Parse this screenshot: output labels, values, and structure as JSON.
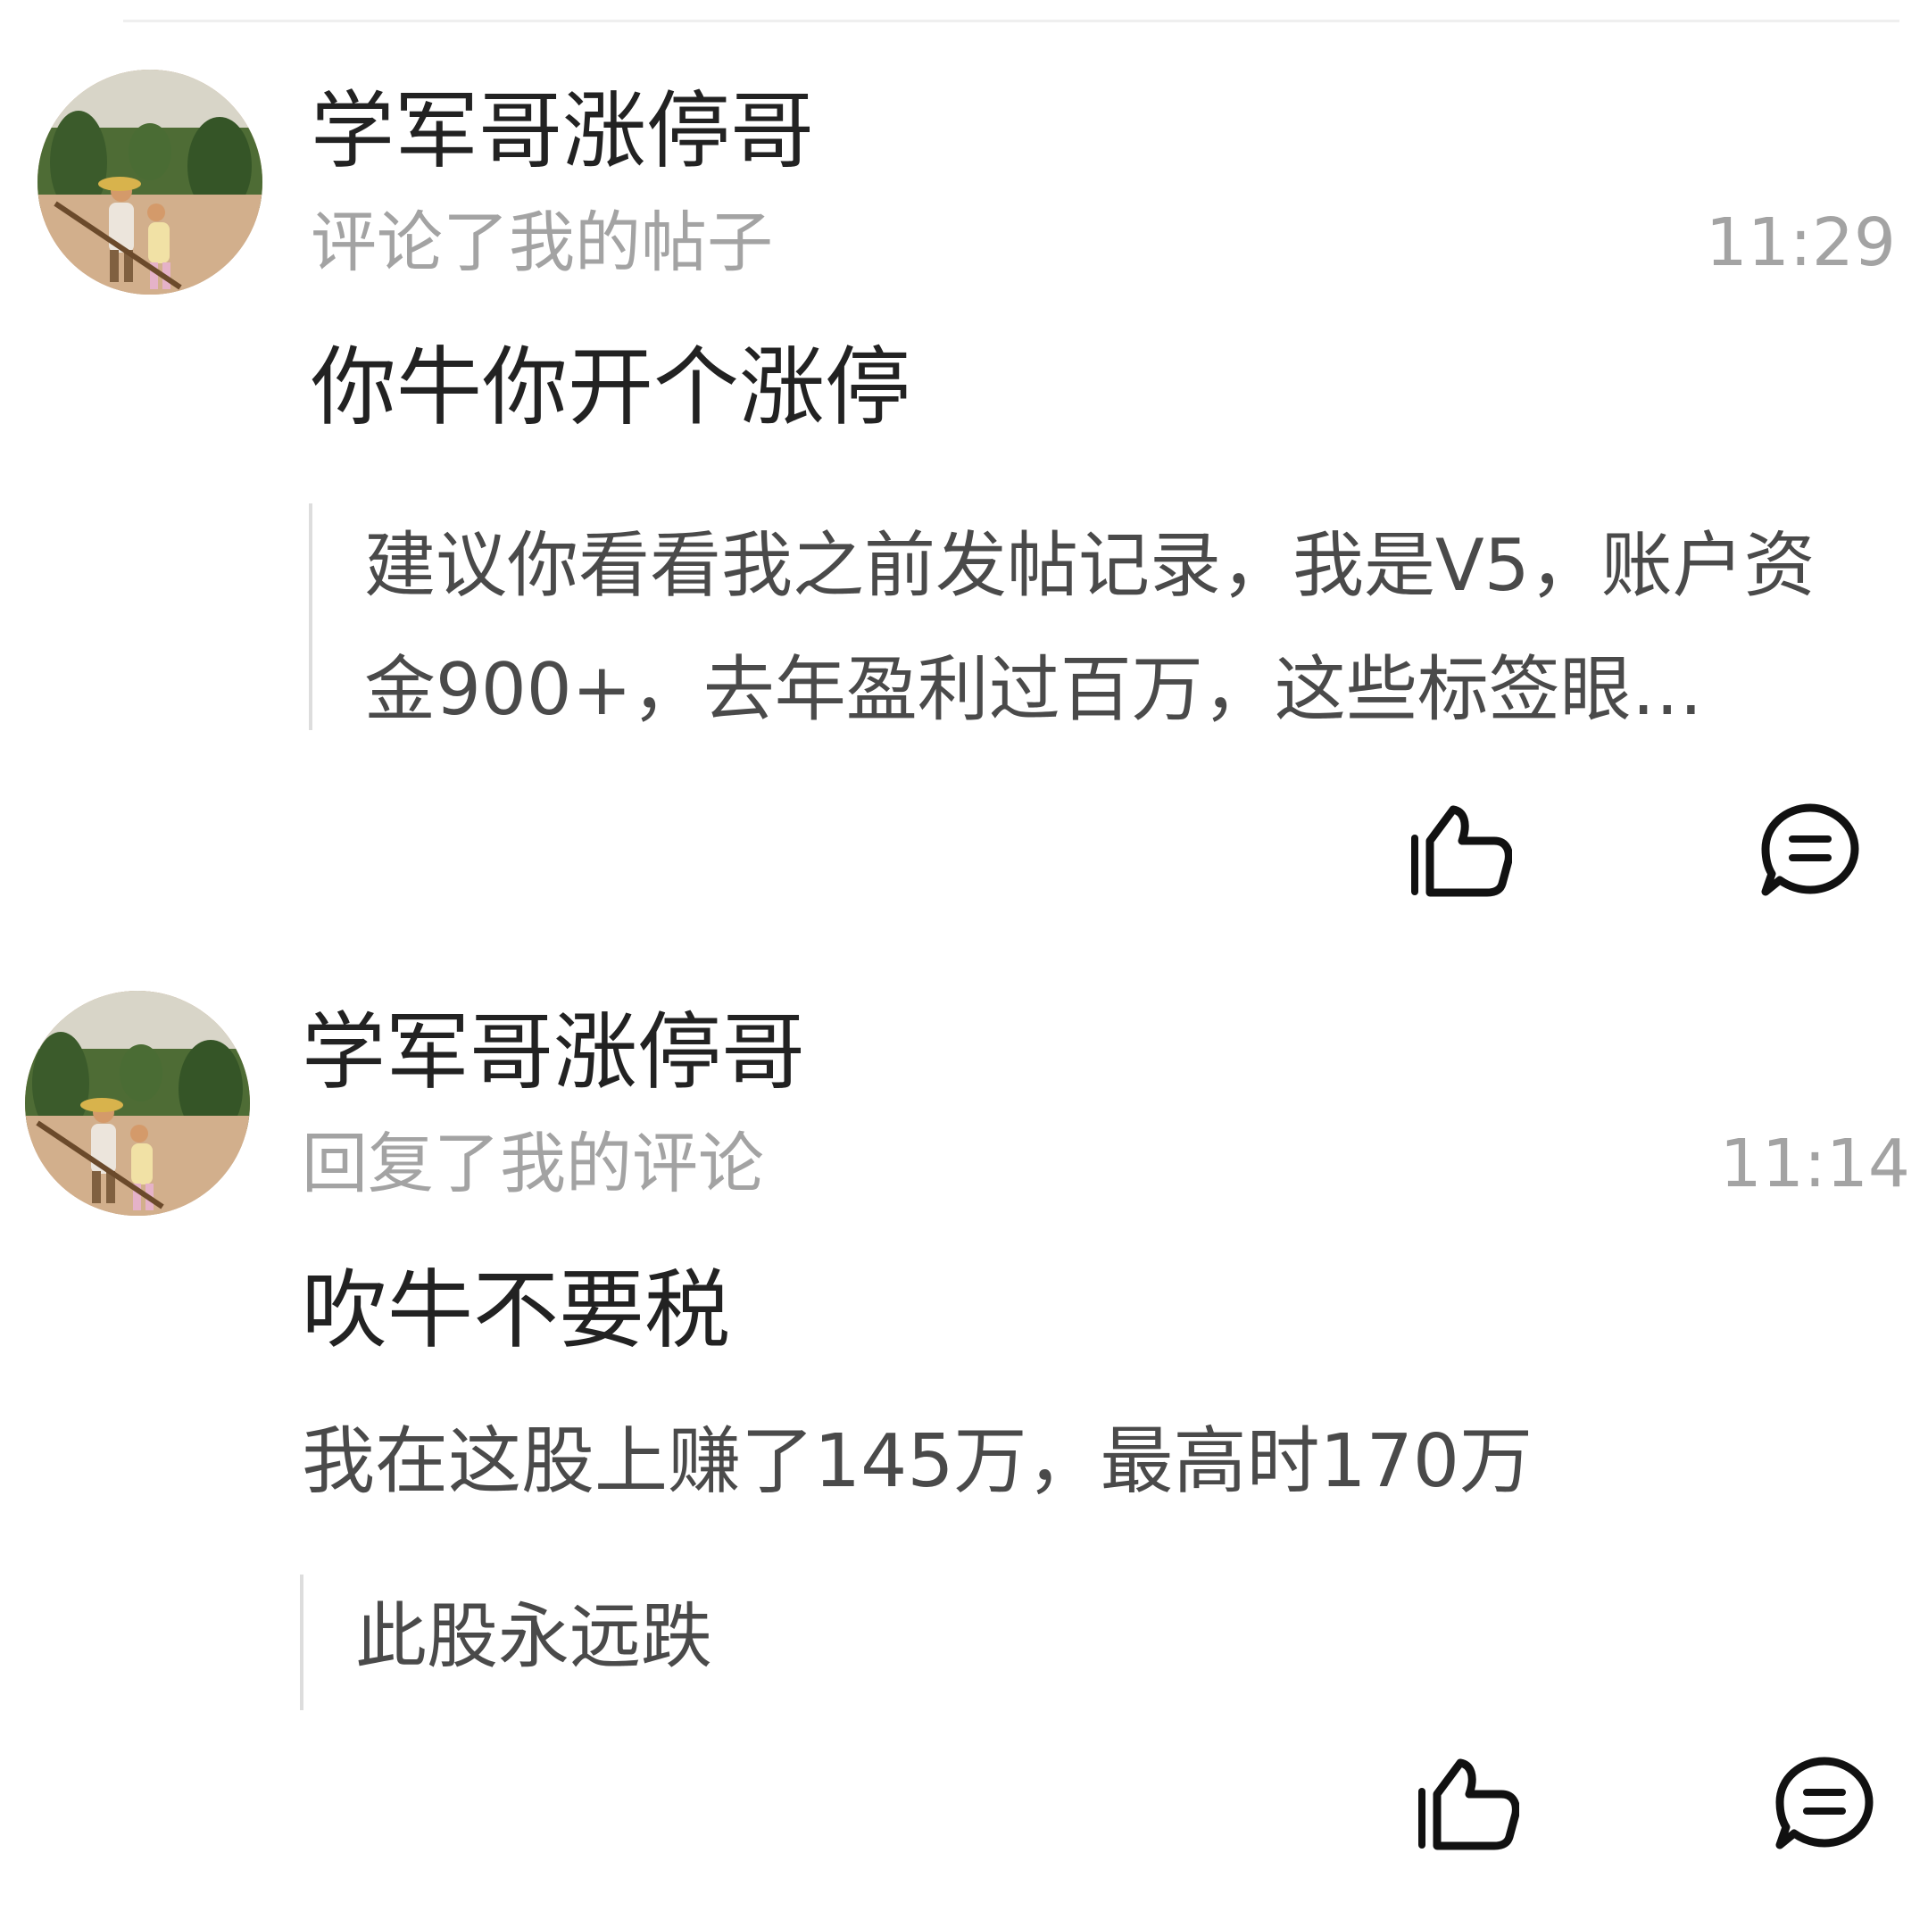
{
  "notifications": [
    {
      "username": "学军哥涨停哥",
      "action": "评论了我的帖子",
      "time": "11:29",
      "comment": "你牛你开个涨停",
      "quote": "建议你看看我之前发帖记录，我是V5，账户资金900+，去年盈利过百万，这些标签眼…",
      "icons": {
        "like": "thumbs-up-icon",
        "reply": "chat-bubble-icon"
      }
    },
    {
      "username": "学军哥涨停哥",
      "action": "回复了我的评论",
      "time": "11:14",
      "comment": "吹牛不要税",
      "reply_context": "我在这股上赚了145万，最高时170万",
      "quote": "此股永远跌",
      "icons": {
        "like": "thumbs-up-icon",
        "reply": "chat-bubble-icon"
      }
    }
  ],
  "colors": {
    "primary_text": "#222222",
    "secondary_text": "#a3a3a3",
    "quote_text": "#4a4a4a",
    "quote_bar": "#dddddd",
    "background": "#ffffff"
  }
}
